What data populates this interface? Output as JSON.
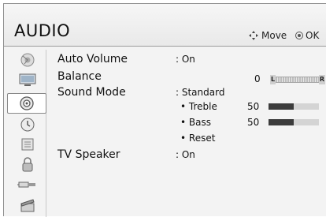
{
  "header": {
    "title": "AUDIO",
    "move_label": "Move",
    "ok_label": "OK"
  },
  "sidebar": {
    "items": [
      {
        "icon": "picture-icon"
      },
      {
        "icon": "tv-screen-icon"
      },
      {
        "icon": "audio-disc-icon",
        "active": true
      },
      {
        "icon": "clock-icon"
      },
      {
        "icon": "keypad-icon"
      },
      {
        "icon": "lock-icon"
      },
      {
        "icon": "input-plug-icon"
      },
      {
        "icon": "movie-clapper-icon"
      }
    ]
  },
  "menu": {
    "auto_volume": {
      "label": "Auto Volume",
      "value": ": On"
    },
    "balance": {
      "label": "Balance",
      "value": "0",
      "left": "L",
      "right": "R"
    },
    "sound_mode": {
      "label": "Sound Mode",
      "value": ": Standard"
    },
    "treble": {
      "label": "• Treble",
      "value": "50",
      "level": 0.5
    },
    "bass": {
      "label": "• Bass",
      "value": "50",
      "level": 0.5
    },
    "reset": {
      "label": "• Reset"
    },
    "tv_speaker": {
      "label": "TV Speaker",
      "value": ": On"
    }
  }
}
